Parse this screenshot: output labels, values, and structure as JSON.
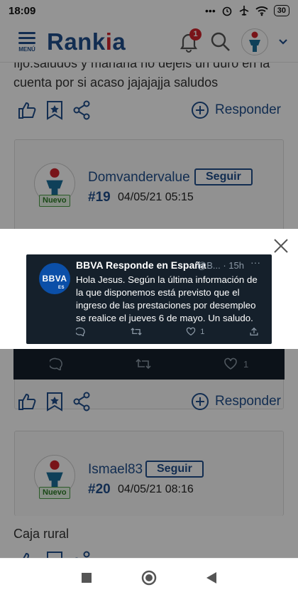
{
  "status_bar": {
    "time": "18:09",
    "dots": "•••",
    "battery": "30"
  },
  "header": {
    "menu_label": "MENÚ",
    "logo_text": "Rankia",
    "notification_count": "1"
  },
  "posts": [
    {
      "text": "fijo.saludos y mañana no dejeis un duro en la cuenta por si acaso jajajajja saludos"
    },
    {
      "username": "Domvandervalue",
      "follow_label": "Seguir",
      "badge": "Nuevo",
      "number": "#19",
      "date": "04/05/21 05:15"
    },
    {
      "username": "Ismael83",
      "follow_label": "Seguir",
      "badge": "Nuevo",
      "number": "#20",
      "date": "04/05/21 08:16",
      "text": "Caja rural"
    }
  ],
  "respond_label": "Responder",
  "background_tweet": {
    "likes": "1"
  },
  "tweet": {
    "author": "BBVA Responde en España",
    "handle": "@B...",
    "time": "· 15h",
    "more": "···",
    "avatar_text": "BBVA",
    "avatar_sub": "ES",
    "text": "Hola Jesus. Según la última información de la que disponemos está previsto que el ingreso de las prestaciones por desempleo se realice el jueves 6 de mayo. Un saludo.",
    "likes": "1"
  },
  "colors": {
    "brand_blue": "#1f4e8c",
    "brand_red": "#d0242b",
    "tweet_bg": "#15202b"
  }
}
